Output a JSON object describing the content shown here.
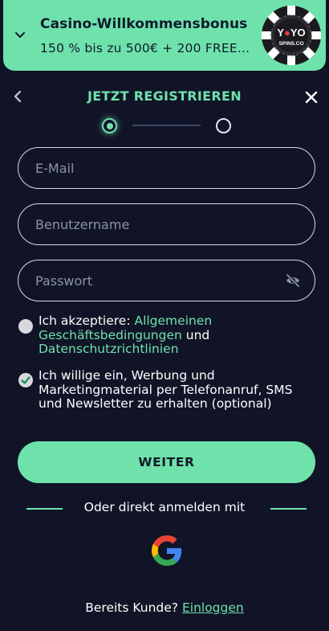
{
  "banner": {
    "title": "Casino-Willkommensbonus",
    "subtitle": "150 % bis zu 500€ + 200 FREE...",
    "brand": "YOYO SPINS.CO",
    "icon": "chevron-down-icon"
  },
  "header": {
    "title": "JETZT REGISTRIEREN",
    "back_icon": "chevron-left-icon",
    "close_icon": "close-icon"
  },
  "steps": {
    "current": 1,
    "total": 2
  },
  "form": {
    "email": {
      "placeholder": "E-Mail",
      "value": ""
    },
    "username": {
      "placeholder": "Benutzername",
      "value": ""
    },
    "password": {
      "placeholder": "Passwort",
      "value": "",
      "toggle_icon": "eye-off-icon"
    }
  },
  "consent_terms": {
    "checked": false,
    "prefix": "Ich akzeptiere: ",
    "link1": "Allgemeinen Geschäftsbedingungen",
    "middle": " und ",
    "link2": "Datenschutzrichtlinien"
  },
  "consent_marketing": {
    "checked": true,
    "text": "Ich willige ein, Werbung und Marketingmaterial per Telefonanruf, SMS und Newsletter zu erhalten (optional)"
  },
  "submit_label": "WEITER",
  "divider_text": "Oder direkt anmelden mit",
  "social": {
    "google_icon": "google-icon"
  },
  "footer": {
    "prefix": "Bereits Kunde? ",
    "login_label": "Einloggen"
  },
  "colors": {
    "accent": "#6fe2ac",
    "background": "#111427",
    "dark_text": "#0f1a2a"
  }
}
